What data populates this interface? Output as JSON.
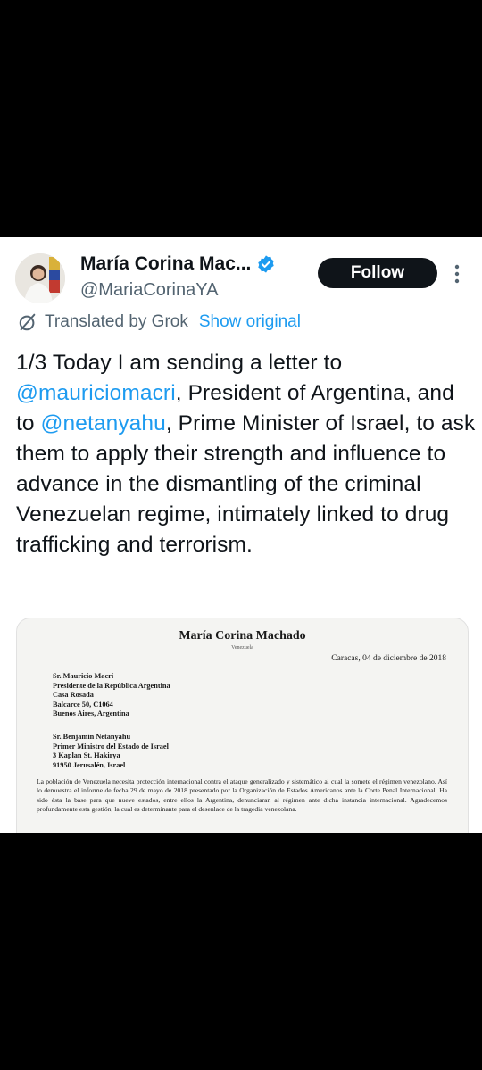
{
  "tweet": {
    "author_name": "María Corina Mac...",
    "handle": "@MariaCorinaYA",
    "follow_label": "Follow",
    "translated_by": "Translated by Grok",
    "show_original": "Show original",
    "text": {
      "part1": "1/3 Today I am sending a letter to ",
      "mention1": "@mauriciomacri",
      "part2": ", President of Argentina, and to ",
      "mention2": "@netanyahu",
      "part3": ", Prime Minister of Israel, to ask them to apply their strength and influence to advance in the dismantling of the criminal Venezuelan regime, intimately linked to drug trafficking and terrorism."
    }
  },
  "letter": {
    "title": "María Corina Machado",
    "subtitle": "Venezuela",
    "date": "Caracas, 04 de diciembre de 2018",
    "recipient1": {
      "l1": "Sr. Mauricio Macri",
      "l2": "Presidente de la República Argentina",
      "l3": "Casa Rosada",
      "l4": "Balcarce 50, C1064",
      "l5": "Buenos Aires, Argentina"
    },
    "recipient2": {
      "l1": "Sr. Benjamin Netanyahu",
      "l2": "Primer Ministro del Estado de Israel",
      "l3": "3 Kaplan St. Hakirya",
      "l4": "91950 Jerusalén, Israel"
    },
    "body": "La población de Venezuela necesita protección internacional contra el ataque generalizado y sistemático al cual la somete el régimen venezolano. Así lo demuestra el informe de fecha 29 de mayo de 2018 presentado por la Organización de Estados Americanos ante la Corte Penal Internacional. Ha sido ésta la base para que nueve estados, entre ellos la Argentina, denunciaran al régimen ante dicha instancia internacional. Agradecemos profundamente esta gestión, la cual es determinante para el desenlace de la tragedia venezolana."
  },
  "colors": {
    "accent": "#1d9bf0",
    "text": "#0f1419",
    "muted": "#536471",
    "follow_bg": "#0f1419"
  }
}
